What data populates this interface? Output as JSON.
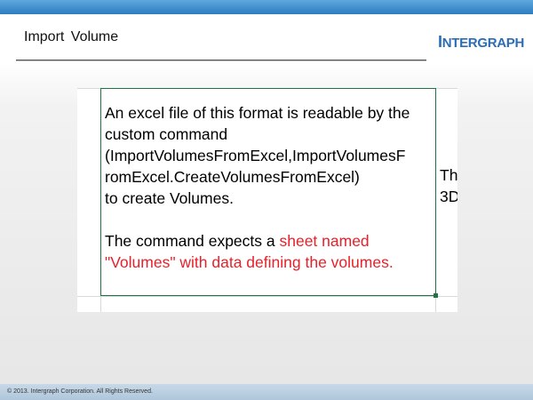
{
  "slide": {
    "title": "Import Volume",
    "logo": {
      "first": "I",
      "rest": "NTERGRAPH"
    },
    "footer": "© 2013. Intergraph Corporation. All Rights Reserved."
  },
  "cell": {
    "lines": [
      "An excel file of this format is readable by the",
      "custom command",
      "(ImportVolumesFromExcel,ImportVolumesF",
      "romExcel.CreateVolumesFromExcel)",
      "to create Volumes."
    ],
    "line6_black": "The command expects a ",
    "line6_red": "sheet named",
    "line7_red": "\"Volumes\" with data defining the volumes."
  },
  "overflow_cells": [
    "Th",
    "3D"
  ],
  "colors": {
    "red_text": "#e8202a",
    "cell_border": "#217346",
    "logo": "#2c6db3"
  }
}
